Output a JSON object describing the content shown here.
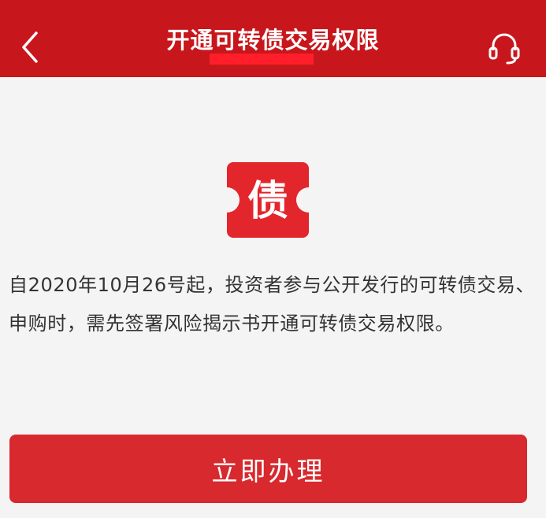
{
  "header": {
    "title": "开通可转债交易权限",
    "bg_color": "#c8171c",
    "back_icon": "chevron-left-icon",
    "support_icon": "headset-icon"
  },
  "icon": {
    "glyph": "债",
    "color": "#e3262c"
  },
  "notice": {
    "text": "自2020年10月26号起，投资者参与公开发行的可转债交易、申购时，需先签署风险揭示书开通可转债交易权限。"
  },
  "action": {
    "button_label": "立即办理",
    "color": "#d7292e"
  }
}
